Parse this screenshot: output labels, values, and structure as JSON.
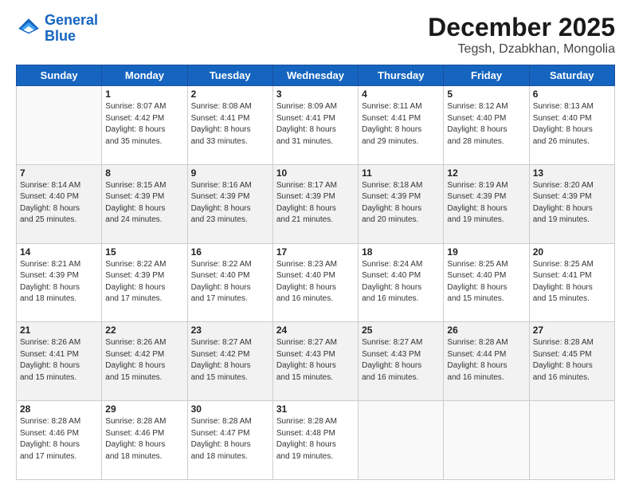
{
  "header": {
    "logo_line1": "General",
    "logo_line2": "Blue",
    "month": "December 2025",
    "location": "Tegsh, Dzabkhan, Mongolia"
  },
  "days_of_week": [
    "Sunday",
    "Monday",
    "Tuesday",
    "Wednesday",
    "Thursday",
    "Friday",
    "Saturday"
  ],
  "weeks": [
    [
      {
        "day": "",
        "text": ""
      },
      {
        "day": "1",
        "text": "Sunrise: 8:07 AM\nSunset: 4:42 PM\nDaylight: 8 hours\nand 35 minutes."
      },
      {
        "day": "2",
        "text": "Sunrise: 8:08 AM\nSunset: 4:41 PM\nDaylight: 8 hours\nand 33 minutes."
      },
      {
        "day": "3",
        "text": "Sunrise: 8:09 AM\nSunset: 4:41 PM\nDaylight: 8 hours\nand 31 minutes."
      },
      {
        "day": "4",
        "text": "Sunrise: 8:11 AM\nSunset: 4:41 PM\nDaylight: 8 hours\nand 29 minutes."
      },
      {
        "day": "5",
        "text": "Sunrise: 8:12 AM\nSunset: 4:40 PM\nDaylight: 8 hours\nand 28 minutes."
      },
      {
        "day": "6",
        "text": "Sunrise: 8:13 AM\nSunset: 4:40 PM\nDaylight: 8 hours\nand 26 minutes."
      }
    ],
    [
      {
        "day": "7",
        "text": "Sunrise: 8:14 AM\nSunset: 4:40 PM\nDaylight: 8 hours\nand 25 minutes."
      },
      {
        "day": "8",
        "text": "Sunrise: 8:15 AM\nSunset: 4:39 PM\nDaylight: 8 hours\nand 24 minutes."
      },
      {
        "day": "9",
        "text": "Sunrise: 8:16 AM\nSunset: 4:39 PM\nDaylight: 8 hours\nand 23 minutes."
      },
      {
        "day": "10",
        "text": "Sunrise: 8:17 AM\nSunset: 4:39 PM\nDaylight: 8 hours\nand 21 minutes."
      },
      {
        "day": "11",
        "text": "Sunrise: 8:18 AM\nSunset: 4:39 PM\nDaylight: 8 hours\nand 20 minutes."
      },
      {
        "day": "12",
        "text": "Sunrise: 8:19 AM\nSunset: 4:39 PM\nDaylight: 8 hours\nand 19 minutes."
      },
      {
        "day": "13",
        "text": "Sunrise: 8:20 AM\nSunset: 4:39 PM\nDaylight: 8 hours\nand 19 minutes."
      }
    ],
    [
      {
        "day": "14",
        "text": "Sunrise: 8:21 AM\nSunset: 4:39 PM\nDaylight: 8 hours\nand 18 minutes."
      },
      {
        "day": "15",
        "text": "Sunrise: 8:22 AM\nSunset: 4:39 PM\nDaylight: 8 hours\nand 17 minutes."
      },
      {
        "day": "16",
        "text": "Sunrise: 8:22 AM\nSunset: 4:40 PM\nDaylight: 8 hours\nand 17 minutes."
      },
      {
        "day": "17",
        "text": "Sunrise: 8:23 AM\nSunset: 4:40 PM\nDaylight: 8 hours\nand 16 minutes."
      },
      {
        "day": "18",
        "text": "Sunrise: 8:24 AM\nSunset: 4:40 PM\nDaylight: 8 hours\nand 16 minutes."
      },
      {
        "day": "19",
        "text": "Sunrise: 8:25 AM\nSunset: 4:40 PM\nDaylight: 8 hours\nand 15 minutes."
      },
      {
        "day": "20",
        "text": "Sunrise: 8:25 AM\nSunset: 4:41 PM\nDaylight: 8 hours\nand 15 minutes."
      }
    ],
    [
      {
        "day": "21",
        "text": "Sunrise: 8:26 AM\nSunset: 4:41 PM\nDaylight: 8 hours\nand 15 minutes."
      },
      {
        "day": "22",
        "text": "Sunrise: 8:26 AM\nSunset: 4:42 PM\nDaylight: 8 hours\nand 15 minutes."
      },
      {
        "day": "23",
        "text": "Sunrise: 8:27 AM\nSunset: 4:42 PM\nDaylight: 8 hours\nand 15 minutes."
      },
      {
        "day": "24",
        "text": "Sunrise: 8:27 AM\nSunset: 4:43 PM\nDaylight: 8 hours\nand 15 minutes."
      },
      {
        "day": "25",
        "text": "Sunrise: 8:27 AM\nSunset: 4:43 PM\nDaylight: 8 hours\nand 16 minutes."
      },
      {
        "day": "26",
        "text": "Sunrise: 8:28 AM\nSunset: 4:44 PM\nDaylight: 8 hours\nand 16 minutes."
      },
      {
        "day": "27",
        "text": "Sunrise: 8:28 AM\nSunset: 4:45 PM\nDaylight: 8 hours\nand 16 minutes."
      }
    ],
    [
      {
        "day": "28",
        "text": "Sunrise: 8:28 AM\nSunset: 4:46 PM\nDaylight: 8 hours\nand 17 minutes."
      },
      {
        "day": "29",
        "text": "Sunrise: 8:28 AM\nSunset: 4:46 PM\nDaylight: 8 hours\nand 18 minutes."
      },
      {
        "day": "30",
        "text": "Sunrise: 8:28 AM\nSunset: 4:47 PM\nDaylight: 8 hours\nand 18 minutes."
      },
      {
        "day": "31",
        "text": "Sunrise: 8:28 AM\nSunset: 4:48 PM\nDaylight: 8 hours\nand 19 minutes."
      },
      {
        "day": "",
        "text": ""
      },
      {
        "day": "",
        "text": ""
      },
      {
        "day": "",
        "text": ""
      }
    ]
  ]
}
